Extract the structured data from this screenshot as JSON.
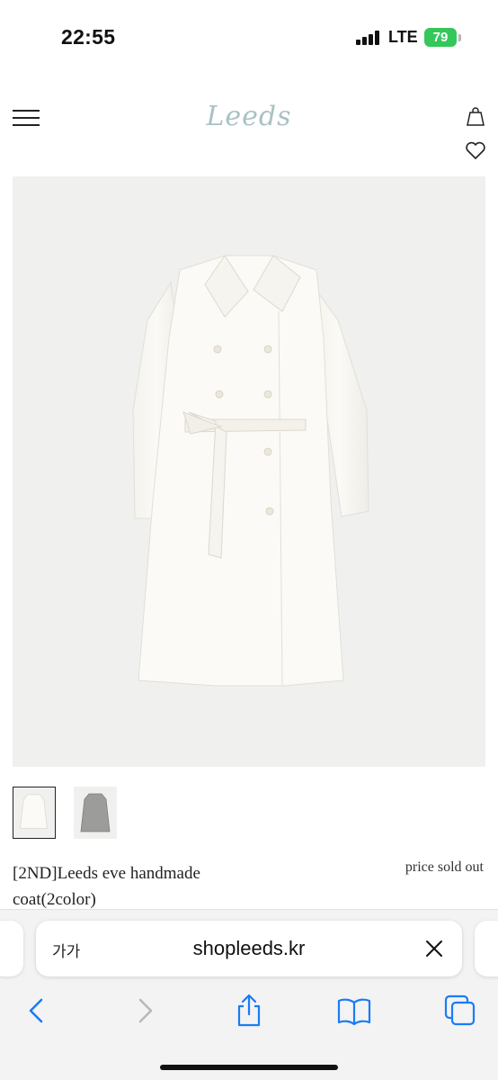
{
  "status_bar": {
    "time": "22:55",
    "network": "LTE",
    "battery": "79"
  },
  "header": {
    "logo": "Leeds",
    "menu_icon": "hamburger-menu-icon",
    "bag_icon": "shopping-bag-icon",
    "wishlist_icon": "heart-icon"
  },
  "product": {
    "name": "[2ND]Leeds eve handmade coat(2color)",
    "price": "price sold out",
    "thumbnails": [
      {
        "color": "ivory",
        "selected": true
      },
      {
        "color": "gray",
        "selected": false
      }
    ]
  },
  "browser": {
    "text_size_label": "가가",
    "url": "shopleeds.kr",
    "toolbar": [
      "back-icon",
      "forward-icon",
      "share-icon",
      "bookmarks-icon",
      "tabs-icon"
    ]
  },
  "colors": {
    "logo": "#a9c1c4",
    "battery": "#34c759",
    "safari_blue": "#1a7cf5",
    "image_bg": "#f0f0ef"
  }
}
